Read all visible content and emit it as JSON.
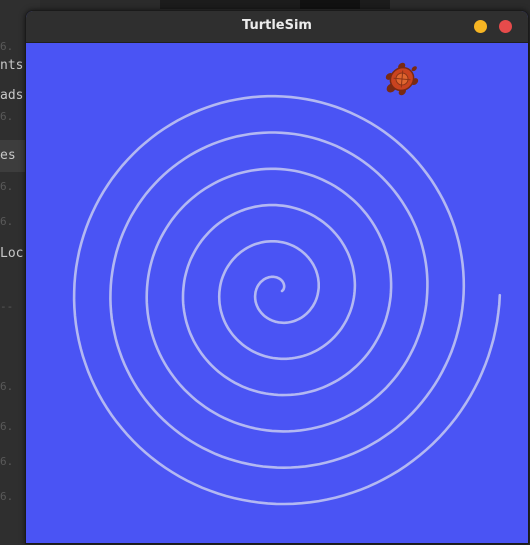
{
  "background": {
    "terminal_fragments": [
      {
        "text": "nts"
      },
      {
        "text": "ads"
      },
      {
        "text": "es"
      },
      {
        "text": "Loc"
      }
    ]
  },
  "window": {
    "title": "TurtleSim",
    "background_color": "#4a54f4",
    "trail_color": "#b3b8f2",
    "buttons": {
      "minimize_color": "#f6b523",
      "close_color": "#e64b4b"
    }
  },
  "turtle": {
    "icon": "turtle-icon",
    "shell_color": "#c9431f"
  },
  "trail": {
    "shape": "spiral",
    "turns": 6
  }
}
